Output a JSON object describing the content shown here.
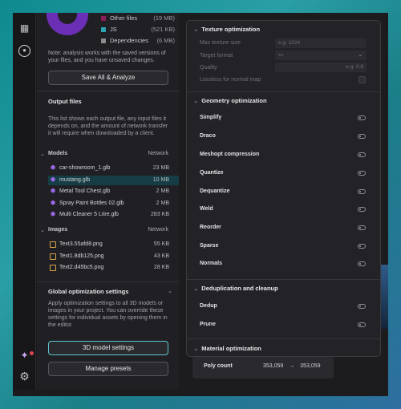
{
  "legend": [
    {
      "label": "Other files",
      "size": "(19 MB)",
      "color": "#8b1f5a"
    },
    {
      "label": "JS",
      "size": "(521 KB)",
      "color": "#2ba3b0"
    },
    {
      "label": "Dependencies",
      "size": "(6 MB)",
      "color": "#8c8c8c"
    }
  ],
  "note": "Note: analysis works with the saved versions of your files, and you have unsaved changes.",
  "save_button": "Save All & Analyze",
  "output": {
    "title": "Output files",
    "description": "This list shows each output file, any input files it depends on, and the amount of network transfer it will require when downloaded by a client."
  },
  "models_group": {
    "title": "Models",
    "column": "Network"
  },
  "models": [
    {
      "name": "car-showroom_1.glb",
      "size": "23 MB"
    },
    {
      "name": "mustang.glb",
      "size": "10 MB"
    },
    {
      "name": "Metal Tool Chest.glb",
      "size": "2 MB"
    },
    {
      "name": "Spray Paint Bottles 02.glb",
      "size": "2 MB"
    },
    {
      "name": "Multi Cleaner 5 Litre.glb",
      "size": "283 KB"
    }
  ],
  "images_group": {
    "title": "Images",
    "column": "Network"
  },
  "images": [
    {
      "name": "Text3.55afd8.png",
      "size": "55 KB"
    },
    {
      "name": "Text1.8db125.png",
      "size": "43 KB"
    },
    {
      "name": "Text2.d45bc5.png",
      "size": "28 KB"
    }
  ],
  "global": {
    "title": "Global optimization settings",
    "description": "Apply optimization settings to all 3D models or images in your project. You can override these settings for individual assets by opening them in the editor.",
    "btn_models": "3D model settings",
    "btn_presets": "Manage presets"
  },
  "texture": {
    "title": "Texture optimization",
    "max_size_label": "Max texture size",
    "max_size_placeholder": "e.g. 1024",
    "format_label": "Target format",
    "format_value": "---",
    "quality_label": "Quality",
    "quality_placeholder": "e.g. 0.8",
    "lossless_label": "Lossless for normal map"
  },
  "geometry": {
    "title": "Geometry optimization",
    "options": [
      "Simplify",
      "Draco",
      "Meshopt compression",
      "Quantize",
      "Dequantize",
      "Weld",
      "Reorder",
      "Sparse",
      "Normals"
    ]
  },
  "dedup": {
    "title": "Deduplication and cleanup",
    "options": [
      "Dedup",
      "Prune"
    ]
  },
  "material": {
    "title": "Material optimization"
  },
  "stats": {
    "label": "Poly count",
    "from": "353,059",
    "arrow": "→",
    "to": "353,059"
  }
}
